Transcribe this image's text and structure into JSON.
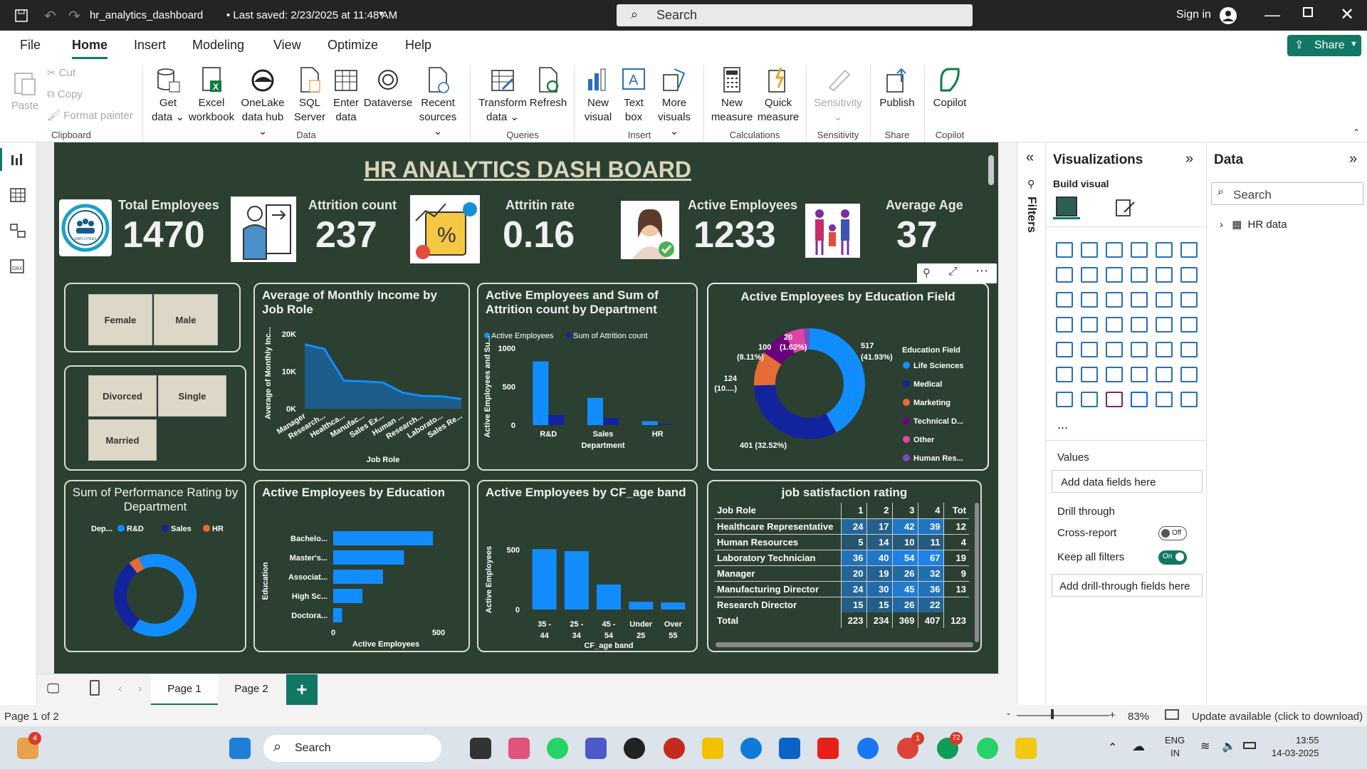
{
  "window": {
    "title": "hr_analytics_dashboard",
    "saved": "• Last saved: 2/23/2025 at 11:48 AM",
    "search": "Search",
    "signin": "Sign in"
  },
  "menu": {
    "items": [
      "File",
      "Home",
      "Insert",
      "Modeling",
      "View",
      "Optimize",
      "Help"
    ],
    "share": "Share"
  },
  "ribbon": {
    "clipboard": {
      "paste": "Paste",
      "cut": "Cut",
      "copy": "Copy",
      "format": "Format painter",
      "group": "Clipboard"
    },
    "data": {
      "get1": "Get",
      "get2": "data",
      "excel1": "Excel",
      "excel2": "workbook",
      "onelake1": "OneLake",
      "onelake2": "data hub",
      "sql1": "SQL",
      "sql2": "Server",
      "enter1": "Enter",
      "enter2": "data",
      "dataverse": "Dataverse",
      "recent1": "Recent",
      "recent2": "sources",
      "group": "Data"
    },
    "queries": {
      "transform1": "Transform",
      "transform2": "data",
      "refresh": "Refresh",
      "group": "Queries"
    },
    "insert": {
      "newvisual1": "New",
      "newvisual2": "visual",
      "textbox1": "Text",
      "textbox2": "box",
      "more1": "More",
      "more2": "visuals",
      "group": "Insert"
    },
    "calc": {
      "newm1": "New",
      "newm2": "measure",
      "quick1": "Quick",
      "quick2": "measure",
      "group": "Calculations"
    },
    "sens": {
      "label": "Sensitivity",
      "group": "Sensitivity"
    },
    "share": {
      "publish": "Publish",
      "group": "Share"
    },
    "copilot": {
      "label": "Copilot",
      "group": "Copilot"
    }
  },
  "dashboard": {
    "title": "HR ANALYTICS DASH BOARD",
    "kpis": [
      {
        "label": "Total Employees",
        "value": "1470"
      },
      {
        "label": "Attrition count",
        "value": "237"
      },
      {
        "label": "Attritin rate",
        "value": "0.16"
      },
      {
        "label": "Active Employees",
        "value": "1233"
      },
      {
        "label": "Average Age",
        "value": "37"
      }
    ],
    "logo_text": "EMPLOYEES",
    "slicers": {
      "gender": [
        "Female",
        "Male"
      ],
      "marital": [
        "Divorced",
        "Single",
        "Married"
      ]
    },
    "charts": {
      "income_title": "Average of Monthly Income by Job Role",
      "dept_title": "Active Employees and Sum of Attrition count by Department",
      "edu_field_title": "Active Employees by Education Field",
      "perf_title": "Sum of Performance Rating by Department",
      "edu_title": "Active Employees by Education",
      "age_title": "Active Employees by CF_age band",
      "js_title": "job satisfaction rating"
    }
  },
  "chart_data": [
    {
      "type": "area",
      "title": "Average of Monthly Income by Job Role",
      "xlabel": "Job Role",
      "ylabel": "Average of Monthly Inc...",
      "categories": [
        "Manager",
        "Research...",
        "Healthca...",
        "Manufac...",
        "Sales Ex...",
        "Human ...",
        "Research...",
        "Laborato...",
        "Sales Re..."
      ],
      "values": [
        17200,
        16000,
        7500,
        7300,
        7000,
        4300,
        3400,
        3300,
        2600
      ],
      "yticks": [
        "20K",
        "10K",
        "0K"
      ],
      "ylim": [
        0,
        20000
      ]
    },
    {
      "type": "bar",
      "title": "Active Employees and Sum of Attrition count by Department",
      "xlabel": "Department",
      "ylabel": "Active Employees and Su...",
      "categories": [
        "R&D",
        "Sales",
        "HR"
      ],
      "series": [
        {
          "name": "Active Employees",
          "values": [
            828,
            354,
            51
          ]
        },
        {
          "name": "Sum of Attrition count",
          "values": [
            133,
            92,
            12
          ]
        }
      ],
      "yticks": [
        "1000",
        "500",
        "0"
      ],
      "ylim": [
        0,
        1000
      ]
    },
    {
      "type": "pie",
      "title": "Active Employees by Education Field",
      "legend_title": "Education Field",
      "labels": [
        "Life Sciences",
        "Medical",
        "Marketing",
        "Technical D...",
        "Other",
        "Human Res..."
      ],
      "values": [
        517,
        401,
        124,
        100,
        70,
        20
      ],
      "colors": [
        "#118dff",
        "#12239e",
        "#e66c37",
        "#6b007b",
        "#e044a7",
        "#744ec2"
      ],
      "data_labels": [
        "517",
        "(41.93%)",
        "401 (32.52%)",
        "124",
        "(10....)",
        "100",
        "(8.11%)",
        "20",
        "(1.62%)"
      ]
    },
    {
      "type": "pie",
      "title": "Sum of Performance Rating by Department",
      "legend_title": "Dep...",
      "labels": [
        "R&D",
        "Sales",
        "HR"
      ],
      "values": [
        1532,
        695,
        98
      ],
      "colors": [
        "#118dff",
        "#12239e",
        "#e66c37"
      ]
    },
    {
      "type": "bar",
      "title": "Active Employees by Education",
      "xlabel": "Active Employees",
      "ylabel": "Education",
      "categories": [
        "Bachelo...",
        "Master's...",
        "Associat...",
        "High Sc...",
        "Doctora..."
      ],
      "values": [
        473,
        336,
        236,
        139,
        42
      ],
      "xticks": [
        "0",
        "500"
      ],
      "xlim": [
        0,
        500
      ]
    },
    {
      "type": "bar",
      "title": "Active Employees by CF_age band",
      "xlabel": "CF_age band",
      "ylabel": "Active Employees",
      "categories": [
        "35 - 44",
        "25 - 34",
        "45 - 54",
        "Under 25",
        "Over 55"
      ],
      "values": [
        505,
        488,
        209,
        64,
        59
      ],
      "yticks": [
        "500",
        "0"
      ],
      "ylim": [
        0,
        500
      ]
    },
    {
      "type": "table",
      "title": "job satisfaction rating",
      "columns": [
        "Job Role",
        "1",
        "2",
        "3",
        "4",
        "Tot"
      ],
      "rows": [
        [
          "Healthcare Representative",
          "24",
          "17",
          "42",
          "39",
          "12"
        ],
        [
          "Human Resources",
          "5",
          "14",
          "10",
          "11",
          "4"
        ],
        [
          "Laboratory Technician",
          "36",
          "40",
          "54",
          "67",
          "19"
        ],
        [
          "Manager",
          "20",
          "19",
          "26",
          "32",
          "9"
        ],
        [
          "Manufacturing Director",
          "24",
          "30",
          "45",
          "36",
          "13"
        ],
        [
          "Research Director",
          "15",
          "15",
          "26",
          "22",
          ""
        ]
      ],
      "total": [
        "Total",
        "223",
        "234",
        "369",
        "407",
        "123"
      ]
    }
  ],
  "viz": {
    "title": "Visualizations",
    "build": "Build visual",
    "values": "Values",
    "add_fields": "Add data fields here",
    "drill": "Drill through",
    "cross": "Cross-report",
    "cross_state": "Off",
    "keep": "Keep all filters",
    "keep_state": "On",
    "add_drill": "Add drill-through fields here",
    "filters": "Filters",
    "more": "..."
  },
  "data": {
    "title": "Data",
    "search": "Search",
    "table": "HR data"
  },
  "tabs": [
    "Page 1",
    "Page 2"
  ],
  "status": {
    "page": "Page 1 of 2",
    "zoom": "83%",
    "update": "Update available (click to download)"
  },
  "taskbar": {
    "search": "Search",
    "lang1": "ENG",
    "lang2": "IN",
    "time": "13:55",
    "date": "14-03-2025",
    "badge1": "4",
    "badge2": "1",
    "badge3": "72"
  }
}
